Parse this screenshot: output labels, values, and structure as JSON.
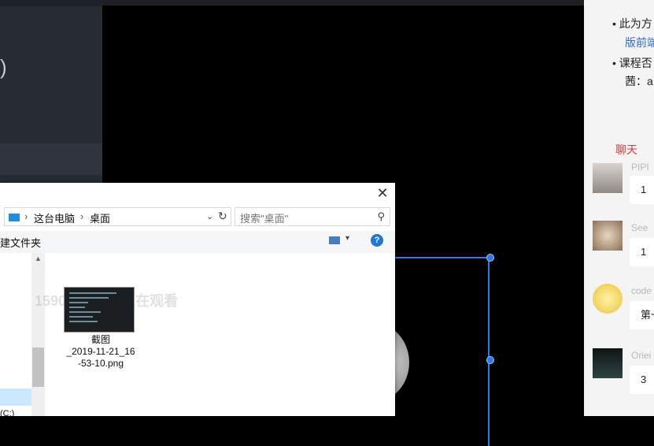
{
  "editor": {
    "paren": ")"
  },
  "panel": {
    "bullets": [
      "此为方",
      "课程否"
    ],
    "link": "版前端",
    "bullet2_cont": "茜：a",
    "chat_tab": "聊天",
    "messages": [
      {
        "name": "PIPI",
        "text": "1"
      },
      {
        "name": "See",
        "text": "1"
      },
      {
        "name": "code",
        "text": "第一"
      },
      {
        "name": "Oriei",
        "text": "3"
      }
    ]
  },
  "dialog": {
    "close": "✕",
    "breadcrumb": [
      "这台电脑",
      "桌面"
    ],
    "search_placeholder": "搜索\"桌面\"",
    "new_folder": "建文件夹",
    "help": "?",
    "drive": "(C:)",
    "file": {
      "name": "截图_2019-11-21_16-53-10.png",
      "name_lines": [
        "截图",
        "_2019-11-21_16",
        "-53-10.png"
      ]
    },
    "watermark": "15900000506正在观看"
  },
  "colors": {
    "accent": "#2f78e8",
    "chat_red": "#d63a3a",
    "link": "#2c6bd1"
  },
  "icons": [
    "close-icon",
    "pc-icon",
    "refresh-icon",
    "search-icon",
    "view-icon",
    "help-icon",
    "scroll-up-icon"
  ]
}
